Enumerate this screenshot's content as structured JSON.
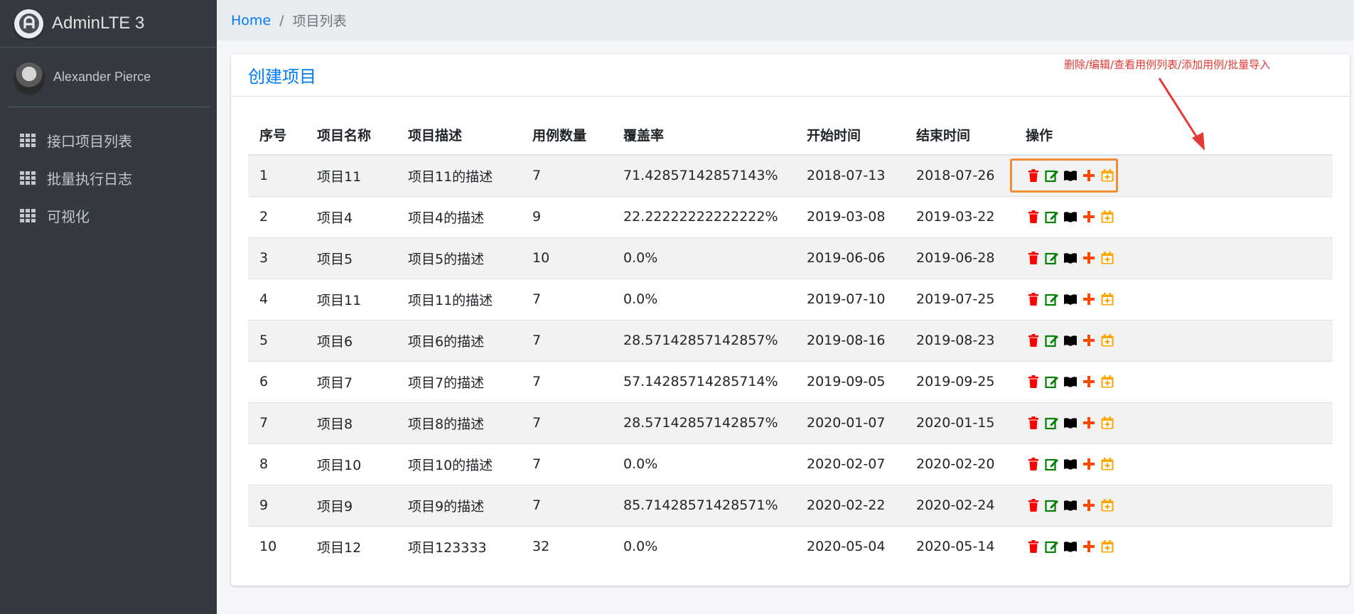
{
  "brand": {
    "name": "AdminLTE 3"
  },
  "user": {
    "name": "Alexander Pierce"
  },
  "sidebar": {
    "items": [
      {
        "label": "接口项目列表"
      },
      {
        "label": "批量执行日志"
      },
      {
        "label": "可视化"
      }
    ]
  },
  "breadcrumb": {
    "home": "Home",
    "separator": "/",
    "current": "项目列表"
  },
  "card": {
    "title": "创建项目"
  },
  "annotation": {
    "text": "删除/编辑/查看用例列表/添加用例/批量导入"
  },
  "table": {
    "headers": [
      "序号",
      "项目名称",
      "项目描述",
      "用例数量",
      "覆盖率",
      "开始时间",
      "结束时间",
      "操作"
    ],
    "rows": [
      [
        "1",
        "项目11",
        "项目11的描述",
        "7",
        "71.42857142857143%",
        "2018-07-13",
        "2018-07-26"
      ],
      [
        "2",
        "项目4",
        "项目4的描述",
        "9",
        "22.22222222222222%",
        "2019-03-08",
        "2019-03-22"
      ],
      [
        "3",
        "项目5",
        "项目5的描述",
        "10",
        "0.0%",
        "2019-06-06",
        "2019-06-28"
      ],
      [
        "4",
        "项目11",
        "项目11的描述",
        "7",
        "0.0%",
        "2019-07-10",
        "2019-07-25"
      ],
      [
        "5",
        "项目6",
        "项目6的描述",
        "7",
        "28.57142857142857%",
        "2019-08-16",
        "2019-08-23"
      ],
      [
        "6",
        "项目7",
        "项目7的描述",
        "7",
        "57.14285714285714%",
        "2019-09-05",
        "2019-09-25"
      ],
      [
        "7",
        "项目8",
        "项目8的描述",
        "7",
        "28.57142857142857%",
        "2020-01-07",
        "2020-01-15"
      ],
      [
        "8",
        "项目10",
        "项目10的描述",
        "7",
        "0.0%",
        "2020-02-07",
        "2020-02-20"
      ],
      [
        "9",
        "项目9",
        "项目9的描述",
        "7",
        "85.71428571428571%",
        "2020-02-22",
        "2020-02-24"
      ],
      [
        "10",
        "项目12",
        "项目123333",
        "32",
        "0.0%",
        "2020-05-04",
        "2020-05-14"
      ]
    ],
    "actions": [
      {
        "name": "delete-icon",
        "color": "#ff0000"
      },
      {
        "name": "edit-icon",
        "color": "#008000"
      },
      {
        "name": "book-icon",
        "color": "#000000"
      },
      {
        "name": "plus-icon",
        "color": "#ff4500"
      },
      {
        "name": "calendar-plus-icon",
        "color": "#ffa500"
      }
    ]
  },
  "colors": {
    "sidebar": "#343a40",
    "link": "#007bff",
    "annotation": "#e53935",
    "highlight": "#f08c34"
  }
}
